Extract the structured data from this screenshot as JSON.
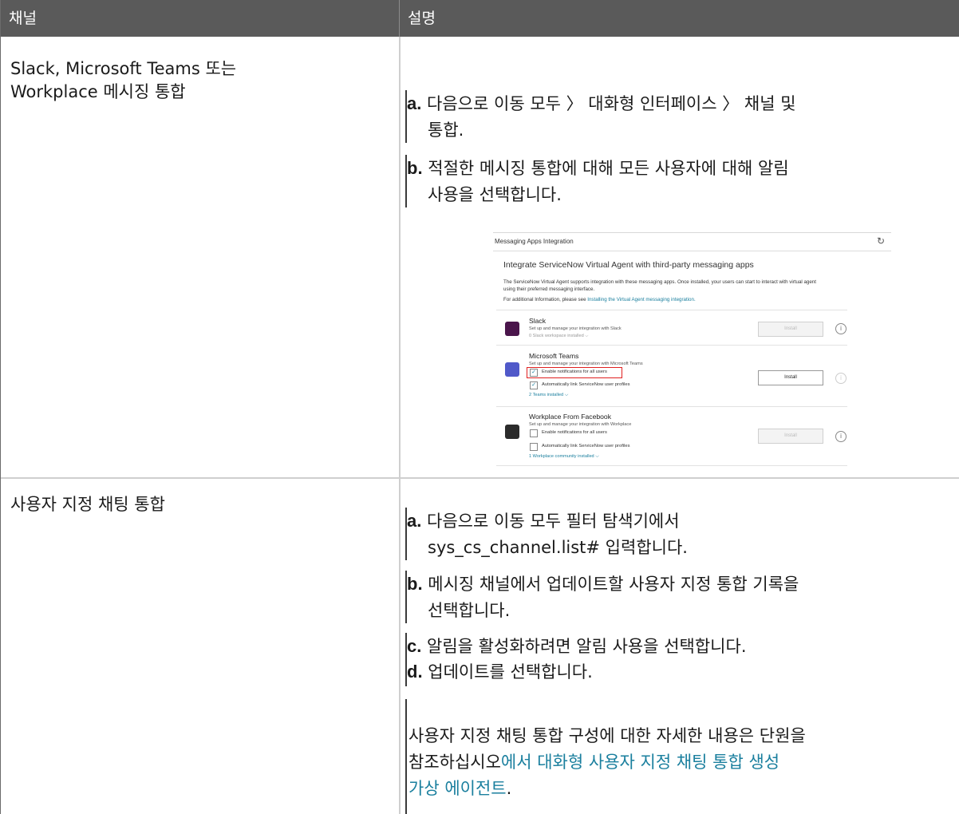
{
  "header": {
    "col1": "채널",
    "col2": "설명"
  },
  "row1": {
    "channel_line1": "Slack, Microsoft Teams 또는",
    "channel_line2": "Workplace 메시징 통합",
    "step_a_label": "a.",
    "step_a_line1": "다음으로 이동 모두 〉 대화형 인터페이스 〉 채널 및",
    "step_a_line2": "통합.",
    "step_b_label": "b.",
    "step_b_line1": "적절한 메시징 통합에 대해 모든 사용자에 대해 알림",
    "step_b_line2": "사용을 선택합니다."
  },
  "screenshot": {
    "bar_title": "Messaging Apps Integration",
    "refresh_glyph": "↻",
    "heading": "Integrate ServiceNow Virtual Agent with third-party messaging apps",
    "desc_line1": "The ServiceNow Virtual Agent supports integration with these messaging apps. Once installed, your users can start to interact with virtual agent",
    "desc_line2": "using their preferred messaging interface.",
    "more_prefix": "For additional Information, please see ",
    "more_link": "Installing the Virtual Agent messaging integration.",
    "apps": [
      {
        "name": "Slack",
        "subtitle": "Set up and manage your integration with Slack",
        "installed": "0 Slack workspace installed",
        "button": "Install",
        "color": "#4a154b"
      },
      {
        "name": "Microsoft Teams",
        "subtitle": "Set up and manage your integration with Microsoft Teams",
        "cb1": "Enable notifications for all users",
        "cb2": "Automatically link ServiceNow user profiles",
        "installed": "2 Teams installed",
        "button": "Install",
        "color": "#5059c9"
      },
      {
        "name": "Workplace From Facebook",
        "subtitle": "Set up and manage your integration with Workplace",
        "cb1": "Enable notifications for all users",
        "cb2": "Automatically link ServiceNow user profiles",
        "installed": "1 Workplace community installed",
        "button": "Install",
        "color": "#2b2b2b"
      }
    ]
  },
  "row2": {
    "channel": "사용자 지정 채팅 통합",
    "step_a_label": "a.",
    "step_a_line1": "다음으로 이동 모두 필터 탐색기에서",
    "step_a_line2": "sys_cs_channel.list# 입력합니다.",
    "step_b_label": "b.",
    "step_b_line1": "메시징 채널에서 업데이트할 사용자 지정 통합 기록을",
    "step_b_line2": "선택합니다.",
    "step_c_label": "c.",
    "step_c_line1": "알림을 활성화하려면 알림 사용을 선택합니다.",
    "step_d_label": "d.",
    "step_d_line1": "업데이트를 선택합니다.",
    "note_line1": "사용자 지정 채팅 통합 구성에 대한 자세한 내용은 단원을",
    "note_line2_plain": "참조하십시오",
    "note_line2_link": "에서 대화형 사용자 지정 채팅 통합 생성",
    "note_line3_link": "가상 에이전트",
    "note_line3_end": "."
  }
}
